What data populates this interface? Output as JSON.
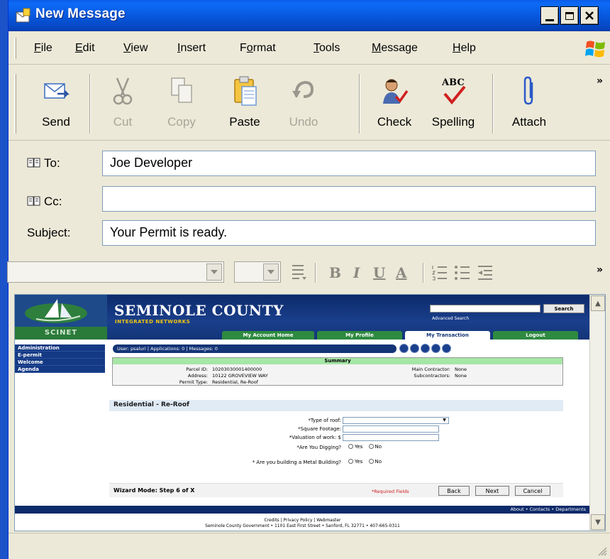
{
  "window": {
    "title": "New Message"
  },
  "menu": [
    "File",
    "Edit",
    "View",
    "Insert",
    "Format",
    "Tools",
    "Message",
    "Help"
  ],
  "menu_underline": [
    "F",
    "E",
    "V",
    "I",
    "o",
    "T",
    "M",
    "H"
  ],
  "toolbar": {
    "send": "Send",
    "cut": "Cut",
    "copy": "Copy",
    "paste": "Paste",
    "undo": "Undo",
    "check": "Check",
    "spelling": "Spelling",
    "attach": "Attach",
    "spelling_icon_text": "ABC"
  },
  "header": {
    "to_label": "To:",
    "cc_label": "Cc:",
    "subject_label": "Subject:",
    "to_value": "Joe Developer",
    "cc_value": "",
    "subject_value": "Your Permit is ready."
  },
  "site": {
    "county_title": "SEMINOLE COUNTY",
    "county_sub": "INTEGRATED NETWORKS",
    "logo_text": "SCINET",
    "search_button": "Search",
    "advanced_search": "Advanced Search",
    "tabs": [
      "My Account Home",
      "My Profile",
      "My Transaction",
      "Logout"
    ],
    "left_nav": [
      "Administration",
      "E-permit",
      "Welcome",
      "Agenda"
    ],
    "user_bar": "User: psaluri | Applications: 0 | Messages: 0",
    "summary": {
      "title": "Summary",
      "parcel_label": "Parcel ID:",
      "parcel_value": "10203030001400000",
      "address_label": "Address:",
      "address_value": "10122 GROVEVIEW WAY",
      "permit_type_label": "Permit Type:",
      "permit_type_value": "Residential, Re-Roof",
      "main_contractor_label": "Main Contractor:",
      "main_contractor_value": "None",
      "subcontractors_label": "Subcontractors:",
      "subcontractors_value": "None"
    },
    "section_title": "Residential - Re-Roof",
    "fields": {
      "type_of_roof": "*Type of roof:",
      "square_footage": "*Square Footage:",
      "valuation": "*Valuation of work: $",
      "digging": "*Are You Digging?",
      "metal_building": "* Are you building a Metal Building?",
      "yes": "Yes",
      "no": "No"
    },
    "wizard": {
      "label": "Wizard Mode: Step 6 of X",
      "required": "*Required Fields",
      "back": "Back",
      "next": "Next",
      "cancel": "Cancel"
    },
    "footer_links": "About • Contacts • Departments",
    "footer_line1": "Credits | Privacy Policy | Webmaster",
    "footer_line2": "Seminole County Government • 1101 East First Street • Sanford, FL 32771 • 407-665-0311"
  }
}
